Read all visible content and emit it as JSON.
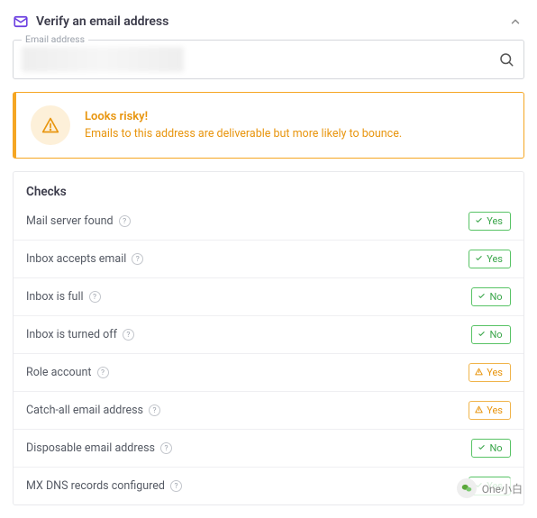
{
  "header": {
    "title": "Verify an email address"
  },
  "field": {
    "label": "Email address",
    "value": ""
  },
  "alert": {
    "title": "Looks risky!",
    "message": "Emails to this address are deliverable but more likely to bounce."
  },
  "checks": {
    "heading": "Checks",
    "items": [
      {
        "label": "Mail server found",
        "badge": "Yes",
        "status": "ok"
      },
      {
        "label": "Inbox accepts email",
        "badge": "Yes",
        "status": "ok"
      },
      {
        "label": "Inbox is full",
        "badge": "No",
        "status": "ok"
      },
      {
        "label": "Inbox is turned off",
        "badge": "No",
        "status": "ok"
      },
      {
        "label": "Role account",
        "badge": "Yes",
        "status": "warn"
      },
      {
        "label": "Catch-all email address",
        "badge": "Yes",
        "status": "warn"
      },
      {
        "label": "Disposable email address",
        "badge": "No",
        "status": "ok"
      },
      {
        "label": "MX DNS records configured",
        "badge": "Yes",
        "status": "ok"
      }
    ]
  },
  "watermark": {
    "text": "One小白"
  },
  "help_glyph": "?"
}
